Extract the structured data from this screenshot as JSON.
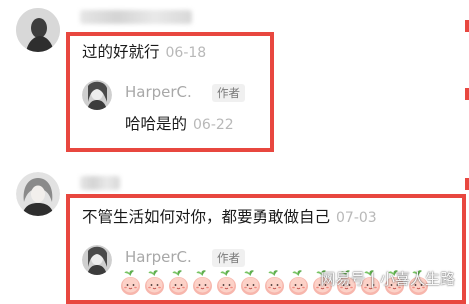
{
  "comments": [
    {
      "text": "过的好就行",
      "date": "06-18",
      "reply": {
        "username": "HarperC.",
        "badge": "作者",
        "text": "哈哈是的",
        "date": "06-22"
      }
    },
    {
      "text": "不管生活如何对你，都要勇敢做自己",
      "date": "07-03",
      "reply": {
        "username": "HarperC.",
        "badge": "作者"
      }
    }
  ],
  "emoji": {
    "name": "peach-face-emoji",
    "count": 13
  },
  "watermark": "网易号 | 小喜人生路",
  "colors": {
    "highlight": "#e8473f",
    "date": "#b8b8b8",
    "username": "#a8a8a8"
  }
}
